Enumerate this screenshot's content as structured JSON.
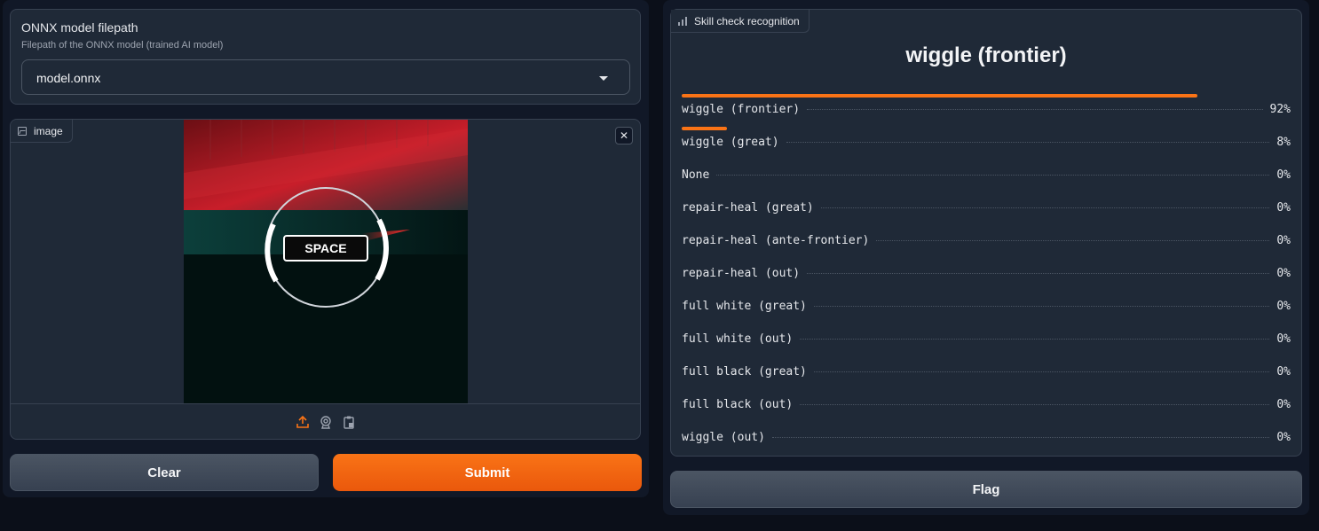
{
  "model_input": {
    "title": "ONNX model filepath",
    "info": "Filepath of the ONNX model (trained AI model)",
    "value": "model.onnx"
  },
  "image_input": {
    "label": "image",
    "overlay_text": "SPACE",
    "sources": [
      "upload-icon",
      "webcam-icon",
      "clipboard-icon"
    ]
  },
  "buttons": {
    "clear": "Clear",
    "submit": "Submit",
    "flag": "Flag"
  },
  "output": {
    "label": "Skill check recognition",
    "top_label": "wiggle (frontier)",
    "confidences": [
      {
        "name": "wiggle (frontier)",
        "value": "92%",
        "fraction": 0.92
      },
      {
        "name": "wiggle (great)",
        "value": "8%",
        "fraction": 0.08
      },
      {
        "name": "None",
        "value": "0%",
        "fraction": 0
      },
      {
        "name": "repair-heal (great)",
        "value": "0%",
        "fraction": 0
      },
      {
        "name": "repair-heal (ante-frontier)",
        "value": "0%",
        "fraction": 0
      },
      {
        "name": "repair-heal (out)",
        "value": "0%",
        "fraction": 0
      },
      {
        "name": "full white (great)",
        "value": "0%",
        "fraction": 0
      },
      {
        "name": "full white (out)",
        "value": "0%",
        "fraction": 0
      },
      {
        "name": "full black (great)",
        "value": "0%",
        "fraction": 0
      },
      {
        "name": "full black (out)",
        "value": "0%",
        "fraction": 0
      },
      {
        "name": "wiggle (out)",
        "value": "0%",
        "fraction": 0
      }
    ]
  },
  "colors": {
    "accent": "#f97316",
    "panel": "#1f2937",
    "background": "#0b0f19"
  }
}
